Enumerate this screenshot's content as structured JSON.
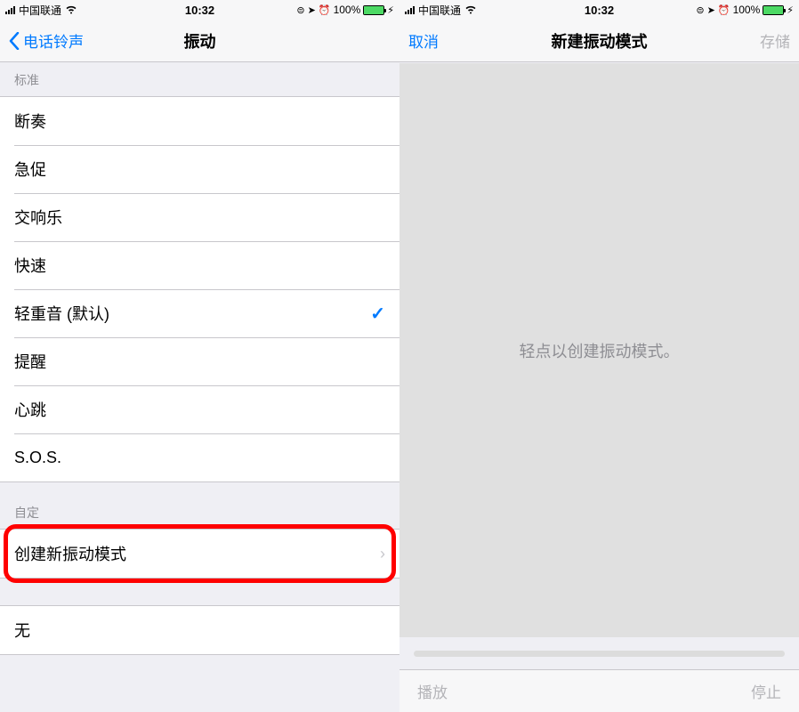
{
  "status": {
    "carrier": "中国联通",
    "time": "10:32",
    "battery_pct": "100%"
  },
  "left_screen": {
    "nav": {
      "back_label": "电话铃声",
      "title": "振动"
    },
    "sections": {
      "standard": {
        "header": "标准",
        "items": [
          {
            "label": "断奏",
            "selected": false
          },
          {
            "label": "急促",
            "selected": false
          },
          {
            "label": "交响乐",
            "selected": false
          },
          {
            "label": "快速",
            "selected": false
          },
          {
            "label": "轻重音 (默认)",
            "selected": true
          },
          {
            "label": "提醒",
            "selected": false
          },
          {
            "label": "心跳",
            "selected": false
          },
          {
            "label": "S.O.S.",
            "selected": false
          }
        ]
      },
      "custom": {
        "header": "自定",
        "create_label": "创建新振动模式"
      },
      "none_label": "无"
    }
  },
  "right_screen": {
    "nav": {
      "cancel": "取消",
      "title": "新建振动模式",
      "save": "存储"
    },
    "tap_hint": "轻点以创建振动模式。",
    "toolbar": {
      "play": "播放",
      "stop": "停止"
    }
  }
}
